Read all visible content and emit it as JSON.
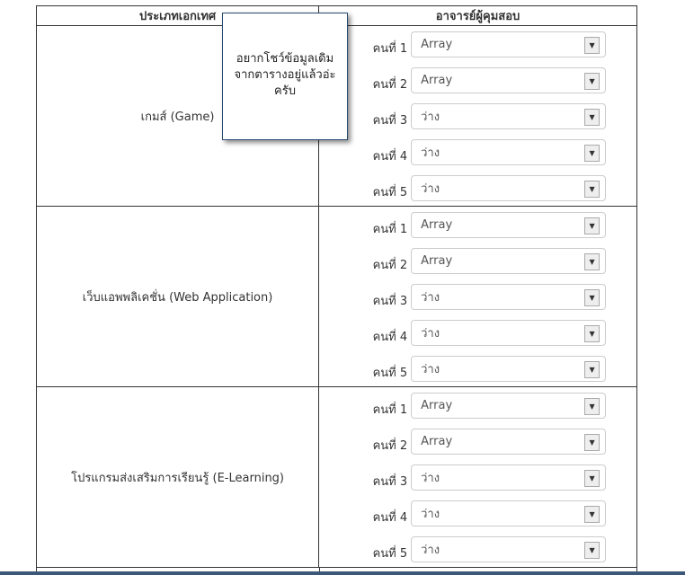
{
  "table": {
    "headers": [
      "ประเภทเอกเทศ",
      "อาจารย์ผู้คุมสอบ"
    ],
    "groups": [
      {
        "category": "เกมส์ (Game)",
        "slots": [
          {
            "label": "คนที่ 1",
            "value": "Array"
          },
          {
            "label": "คนที่ 2",
            "value": "Array"
          },
          {
            "label": "คนที่ 3",
            "value": "ว่าง"
          },
          {
            "label": "คนที่ 4",
            "value": "ว่าง"
          },
          {
            "label": "คนที่ 5",
            "value": "ว่าง"
          }
        ]
      },
      {
        "category": "เว็บแอพพลิเคชั่น (Web Application)",
        "slots": [
          {
            "label": "คนที่ 1",
            "value": "Array"
          },
          {
            "label": "คนที่ 2",
            "value": "Array"
          },
          {
            "label": "คนที่ 3",
            "value": "ว่าง"
          },
          {
            "label": "คนที่ 4",
            "value": "ว่าง"
          },
          {
            "label": "คนที่ 5",
            "value": "ว่าง"
          }
        ]
      },
      {
        "category": "โปรแกรมส่งเสริมการเรียนรู้ (E-Learning)",
        "slots": [
          {
            "label": "คนที่ 1",
            "value": "Array"
          },
          {
            "label": "คนที่ 2",
            "value": "Array"
          },
          {
            "label": "คนที่ 3",
            "value": "ว่าง"
          },
          {
            "label": "คนที่ 4",
            "value": "ว่าง"
          },
          {
            "label": "คนที่ 5",
            "value": "ว่าง"
          }
        ]
      }
    ]
  },
  "popup": {
    "lines": [
      "อยากโชว์ข้อมูลเดิม",
      "จากตารางอยู่แล้วอ่ะ",
      "ครับ"
    ]
  }
}
